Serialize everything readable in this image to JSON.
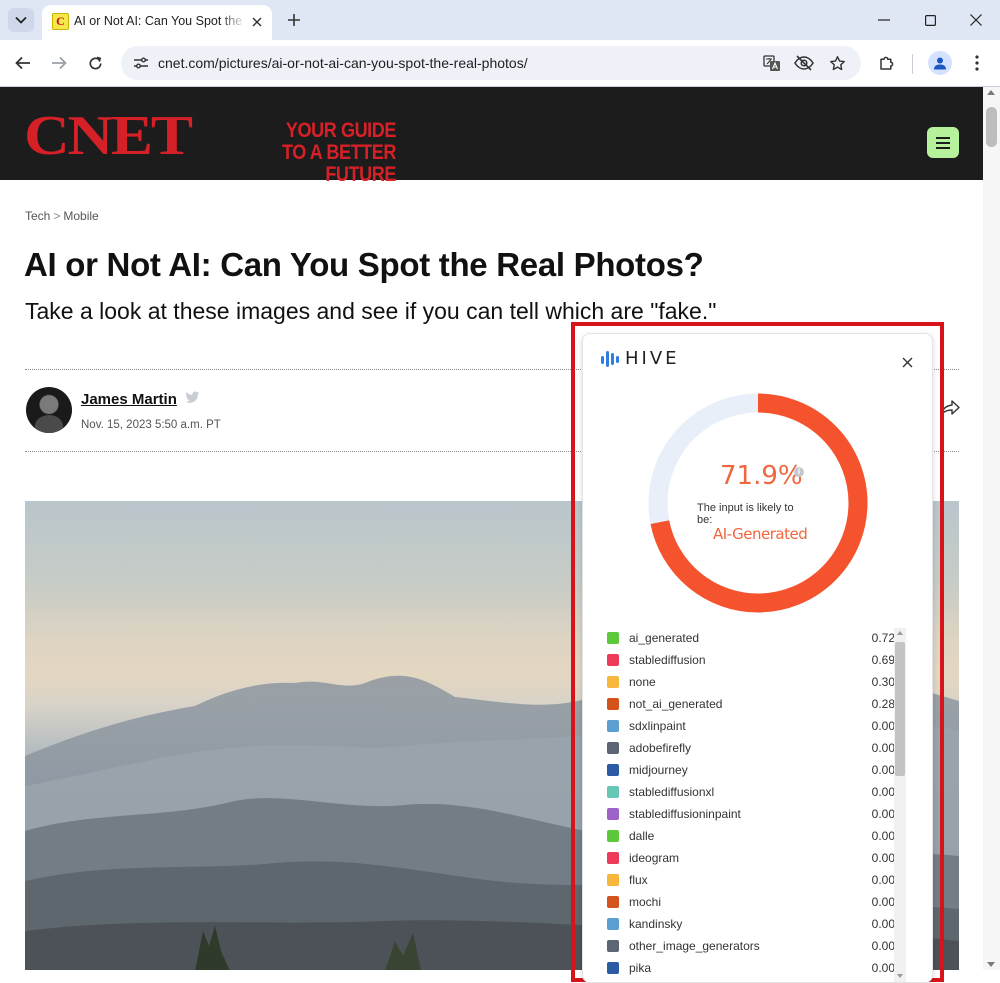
{
  "browser": {
    "tab_title": "AI or Not AI: Can You Spot the Real Photos? - CNET",
    "favicon_letter": "C",
    "url": "cnet.com/pictures/ai-or-not-ai-can-you-spot-the-real-photos/",
    "icons": {
      "tab_search": "chevron-down-icon",
      "tab_close": "close-icon",
      "new_tab": "plus-icon",
      "minimize": "minimize-icon",
      "maximize": "maximize-icon",
      "close_window": "close-icon",
      "back": "back-arrow-icon",
      "forward": "forward-arrow-icon",
      "reload": "reload-icon",
      "site_info": "tune-icon",
      "translate": "translate-icon",
      "tracking": "eye-off-icon",
      "bookmark": "star-icon",
      "extensions": "puzzle-icon",
      "profile": "person-icon",
      "menu": "kebab-menu-icon"
    }
  },
  "site": {
    "logo": "CNET",
    "tagline_line1": "YOUR GUIDE",
    "tagline_line2": "TO A BETTER FUTURE",
    "brand_red": "#d62027",
    "menu_button_color": "#b6f29c"
  },
  "article": {
    "breadcrumb": {
      "section": "Tech",
      "separator": ">",
      "subsection": "Mobile"
    },
    "title": "AI or Not AI: Can You Spot the Real Photos?",
    "subtitle": "Take a look at these images and see if you can tell which are \"fake.\"",
    "author": "James Martin",
    "date": "Nov. 15, 2023 5:50 a.m. PT"
  },
  "hive": {
    "brand": "HIVE",
    "score": "71.9%",
    "likely_text": "The input is likely to be:",
    "verdict": "AI-Generated",
    "accent_color": "#f4532d",
    "track_color": "#e9eff8",
    "score_fraction": 0.719,
    "classes": [
      {
        "name": "ai_generated",
        "score": "0.72",
        "color": "#5cc93a"
      },
      {
        "name": "stablediffusion",
        "score": "0.69",
        "color": "#ee3a5a"
      },
      {
        "name": "none",
        "score": "0.30",
        "color": "#f6b73c"
      },
      {
        "name": "not_ai_generated",
        "score": "0.28",
        "color": "#d4531d"
      },
      {
        "name": "sdxlinpaint",
        "score": "0.00",
        "color": "#5b9fd0"
      },
      {
        "name": "adobefirefly",
        "score": "0.00",
        "color": "#5c6573"
      },
      {
        "name": "midjourney",
        "score": "0.00",
        "color": "#2c5aa3"
      },
      {
        "name": "stablediffusionxl",
        "score": "0.00",
        "color": "#68c6b6"
      },
      {
        "name": "stablediffusioninpaint",
        "score": "0.00",
        "color": "#9d63c8"
      },
      {
        "name": "dalle",
        "score": "0.00",
        "color": "#5cc93a"
      },
      {
        "name": "ideogram",
        "score": "0.00",
        "color": "#ee3a5a"
      },
      {
        "name": "flux",
        "score": "0.00",
        "color": "#f6b73c"
      },
      {
        "name": "mochi",
        "score": "0.00",
        "color": "#d4531d"
      },
      {
        "name": "kandinsky",
        "score": "0.00",
        "color": "#5b9fd0"
      },
      {
        "name": "other_image_generators",
        "score": "0.00",
        "color": "#5c6573"
      },
      {
        "name": "pika",
        "score": "0.00",
        "color": "#2c5aa3"
      }
    ]
  }
}
